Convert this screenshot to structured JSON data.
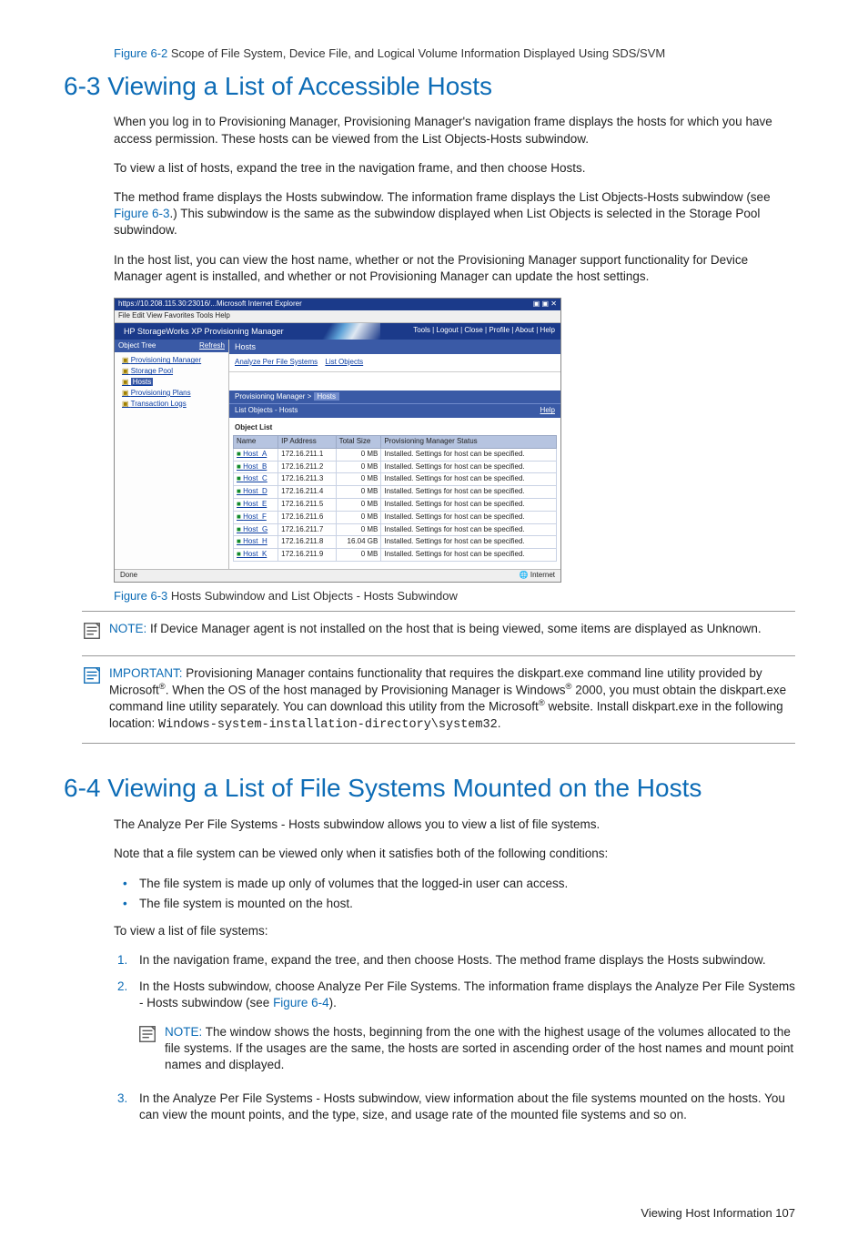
{
  "fig62": {
    "ref": "Figure 6-2",
    "caption": " Scope of File System, Device File, and Logical Volume Information Displayed Using SDS/SVM"
  },
  "sec63": {
    "title": "6-3 Viewing a List of Accessible Hosts",
    "p1": "When you log in to Provisioning Manager, Provisioning Manager's navigation frame displays the hosts for which you have access permission. These hosts can be viewed from the List Objects-Hosts subwindow.",
    "p2": "To view a list of hosts, expand the tree in the navigation frame, and then choose Hosts.",
    "p3a": "The method frame displays the Hosts subwindow. The information frame displays the List Objects-Hosts subwindow (see ",
    "p3link": "Figure 6-3",
    "p3b": ".) This subwindow is the same as the subwindow displayed when List Objects is selected in the Storage Pool subwindow.",
    "p4": "In the host list, you can view the host name, whether or not the Provisioning Manager support functionality for Device Manager agent is installed, and whether or not Provisioning Manager can update the host settings."
  },
  "screenshot": {
    "titlebar_url_fragment": "https://10.208.115.30:23016/...Microsoft Internet Explorer",
    "window_buttons": "▣ ▣ ✕",
    "menubar": "File   Edit   View   Favorites   Tools   Help",
    "brand": "HP StorageWorks XP Provisioning Manager",
    "brand_links": "Tools | Logout | Close | Profile | About | Help",
    "tree_head": "Object Tree",
    "tree_refresh": "Refresh",
    "tree_items": [
      "Provisioning Manager",
      "Storage Pool",
      "Hosts",
      "Provisioning Plans",
      "Transaction Logs"
    ],
    "main_head": "Hosts",
    "tabs": [
      "Analyze Per File Systems",
      "List Objects"
    ],
    "crumb_a": "Provisioning Manager > ",
    "crumb_b": "Hosts",
    "sub_title": "List Objects - Hosts",
    "sub_help": "Help",
    "list_label": "Object List",
    "cols": [
      "Name",
      "IP Address",
      "Total Size",
      "Provisioning Manager Status"
    ],
    "rows": [
      {
        "name": "Host_A",
        "ip": "172.16.211.1",
        "size": "0 MB",
        "status": "Installed. Settings for host can be specified."
      },
      {
        "name": "Host_B",
        "ip": "172.16.211.2",
        "size": "0 MB",
        "status": "Installed. Settings for host can be specified."
      },
      {
        "name": "Host_C",
        "ip": "172.16.211.3",
        "size": "0 MB",
        "status": "Installed. Settings for host can be specified."
      },
      {
        "name": "Host_D",
        "ip": "172.16.211.4",
        "size": "0 MB",
        "status": "Installed. Settings for host can be specified."
      },
      {
        "name": "Host_E",
        "ip": "172.16.211.5",
        "size": "0 MB",
        "status": "Installed. Settings for host can be specified."
      },
      {
        "name": "Host_F",
        "ip": "172.16.211.6",
        "size": "0 MB",
        "status": "Installed. Settings for host can be specified."
      },
      {
        "name": "Host_G",
        "ip": "172.16.211.7",
        "size": "0 MB",
        "status": "Installed. Settings for host can be specified."
      },
      {
        "name": "Host_H",
        "ip": "172.16.211.8",
        "size": "16.04 GB",
        "status": "Installed. Settings for host can be specified."
      },
      {
        "name": "Host_K",
        "ip": "172.16.211.9",
        "size": "0 MB",
        "status": "Installed. Settings for host can be specified."
      }
    ],
    "status_left": "Done",
    "status_right": "🌐 Internet"
  },
  "fig63": {
    "ref": "Figure 6-3",
    "caption": " Hosts Subwindow and List Objects - Hosts Subwindow"
  },
  "note1": {
    "lead": "NOTE:  ",
    "text": "If Device Manager agent is not installed on the host that is being viewed, some items are displayed as Unknown."
  },
  "important": {
    "lead": "IMPORTANT:  ",
    "t1": "Provisioning Manager contains functionality that requires the diskpart.exe command line utility provided by Microsoft",
    "t2": ". When the OS of the host managed by Provisioning Manager is Windows",
    "t3": " 2000, you must obtain the diskpart.exe command line utility separately. You can download this utility from the Microsoft",
    "t4": " website. Install diskpart.exe in the following location: ",
    "path": "Windows-system-installation-directory\\system32",
    "t5": "."
  },
  "sec64": {
    "title": "6-4 Viewing a List of File Systems Mounted on the Hosts",
    "p1": "The Analyze Per File Systems - Hosts subwindow allows you to view a list of file systems.",
    "p2": "Note that a file system can be viewed only when it satisfies both of the following conditions:",
    "b1": "The file system is made up only of volumes that the logged-in user can access.",
    "b2": "The file system is mounted on the host.",
    "p3": "To view a list of file systems:",
    "s1": "In the navigation frame, expand the tree, and then choose Hosts. The method frame displays the Hosts subwindow.",
    "s2a": "In the Hosts subwindow, choose Analyze Per File Systems. The information frame displays the Analyze Per File Systems - Hosts subwindow (see ",
    "s2link": "Figure 6-4",
    "s2b": ").",
    "note_lead": "NOTE:  ",
    "note_text": "The window shows the hosts, beginning from the one with the highest usage of the volumes allocated to the file systems. If the usages are the same, the hosts are sorted in ascending order of the host names and mount point names and displayed.",
    "s3": "In the Analyze Per File Systems - Hosts subwindow, view information about the file systems mounted on the hosts. You can view the mount points, and the type, size, and usage rate of the mounted file systems and so on."
  },
  "footer": {
    "text": "Viewing Host Information  107"
  }
}
